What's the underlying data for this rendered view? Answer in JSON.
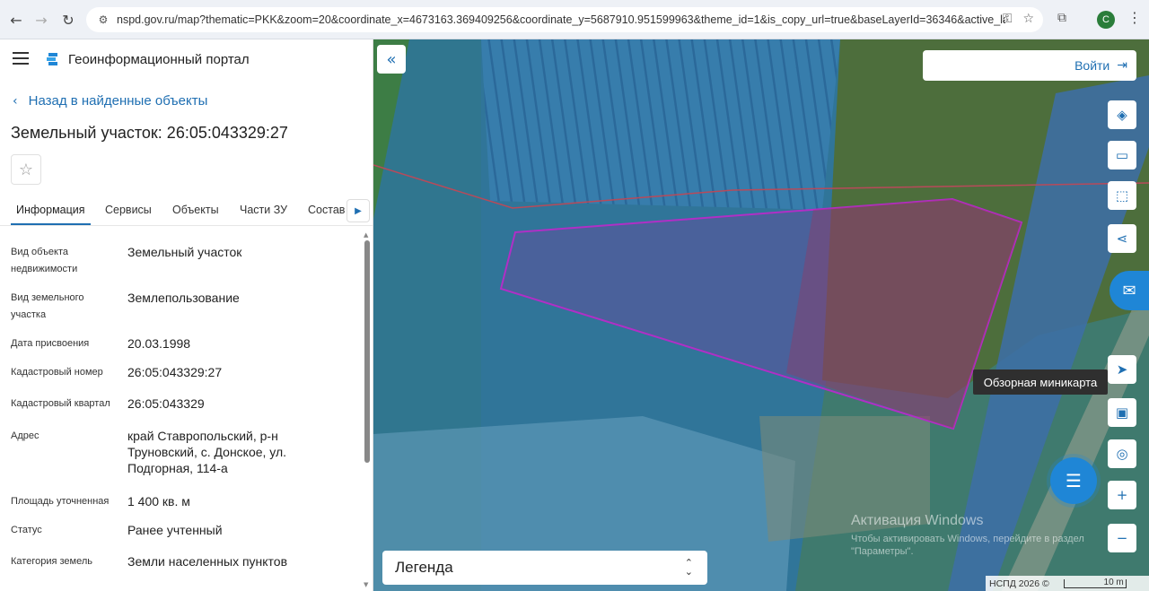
{
  "browser": {
    "url": "nspd.gov.ru/map?thematic=PKK&zoom=20&coordinate_x=4673163.369409256&coordinate_y=5687910.951599963&theme_id=1&is_copy_url=true&baseLayerId=36346&active_layers=3...",
    "profile_initial": "C",
    "icons": {
      "back": "arrow-left-icon",
      "forward": "arrow-right-icon",
      "reload": "reload-icon",
      "key": "key-icon",
      "star": "star-icon",
      "extensions": "puzzle-icon",
      "menu": "kebab-icon"
    }
  },
  "app": {
    "title": "Геоинформационный портал",
    "back_link": "Назад в найденные объекты",
    "object_title": "Земельный участок: 26:05:043329:27"
  },
  "tabs": [
    {
      "label": "Информация",
      "active": true
    },
    {
      "label": "Сервисы",
      "active": false
    },
    {
      "label": "Объекты",
      "active": false
    },
    {
      "label": "Части ЗУ",
      "active": false
    },
    {
      "label": "Состав",
      "active": false
    }
  ],
  "properties": [
    {
      "key": "Вид объекта недвижимости",
      "value": "Земельный участок"
    },
    {
      "key": "Вид земельного участка",
      "value": "Землепользование"
    },
    {
      "key": "Дата присвоения",
      "value": "20.03.1998"
    },
    {
      "key": "Кадастровый номер",
      "value": "26:05:043329:27"
    },
    {
      "key": "Кадастровый квартал",
      "value": "26:05:043329"
    },
    {
      "key": "Адрес",
      "value": "край Ставропольский, р-н Труновский, с. Донское, ул. Подгорная, 114-а"
    },
    {
      "key": "Площадь уточненная",
      "value": "1 400 кв. м"
    },
    {
      "key": "Статус",
      "value": "Ранее учтенный"
    },
    {
      "key": "Категория земель",
      "value": "Земли населенных пунктов"
    }
  ],
  "map": {
    "login_label": "Войти",
    "tooltip": "Обзорная миникарта",
    "legend_label": "Легенда",
    "activation_title": "Активация Windows",
    "activation_text": "Чтобы активировать Windows, перейдите в раздел \"Параметры\".",
    "attribution": "НСПД 2026 ©",
    "scale_label": "10 m",
    "controls": [
      "layers-icon",
      "ruler-icon",
      "select-area-icon",
      "share-icon",
      "locate-icon",
      "minimap-icon",
      "search-location-icon",
      "zoom-in-icon",
      "zoom-out-icon"
    ],
    "colors": {
      "parcel_stroke": "#b02fc6",
      "accent": "#1f6fb2",
      "fab": "#1f86d6"
    }
  }
}
